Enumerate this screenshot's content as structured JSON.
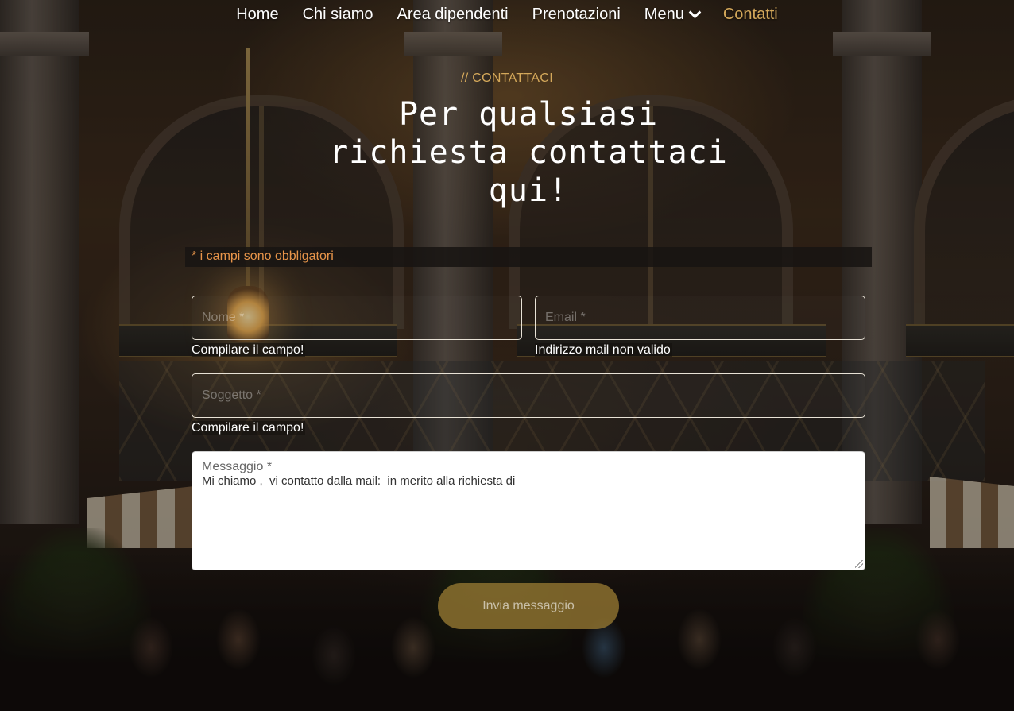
{
  "nav": {
    "items": [
      {
        "label": "Home"
      },
      {
        "label": "Chi siamo"
      },
      {
        "label": "Area dipendenti"
      },
      {
        "label": "Prenotazioni"
      },
      {
        "label": "Menu"
      },
      {
        "label": "Contatti"
      }
    ],
    "active": "Contatti"
  },
  "hero": {
    "eyebrow": "// CONTATTACI",
    "title": "Per qualsiasi richiesta contattaci qui!"
  },
  "form": {
    "required_note": "* i campi sono obbligatori",
    "name": {
      "placeholder": "Nome *",
      "error": "Compilare il campo!"
    },
    "email": {
      "placeholder": "Email *",
      "error": "Indirizzo mail non valido"
    },
    "subject": {
      "placeholder": "Soggetto *",
      "error": "Compilare il campo!"
    },
    "message": {
      "label": "Messaggio *",
      "value": "Mi chiamo ,  vi contatto dalla mail:  in merito alla richiesta di"
    },
    "submit_label": "Invia messaggio"
  },
  "colors": {
    "accent": "#d4a85a",
    "required": "#e8954a",
    "button": "#967832"
  },
  "icons": {
    "menu_dropdown": "chevron-down-icon"
  }
}
